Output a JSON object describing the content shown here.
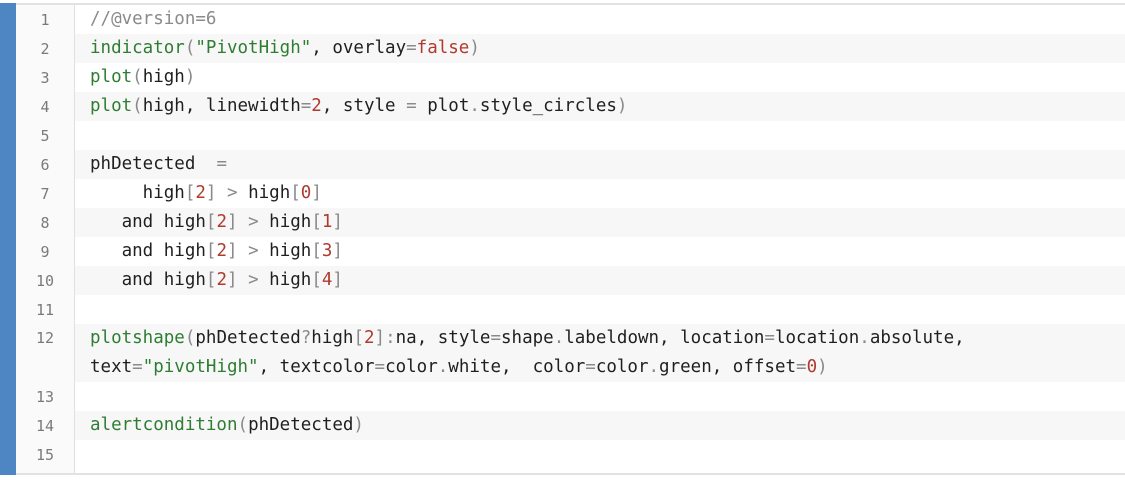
{
  "editor": {
    "accent_color": "#4e86c4",
    "lines": [
      {
        "n": "1",
        "t": "//@version=6"
      },
      {
        "n": "2",
        "t": "indicator(\"PivotHigh\", overlay=false)"
      },
      {
        "n": "3",
        "t": "plot(high)"
      },
      {
        "n": "4",
        "t": "plot(high, linewidth=2, style = plot.style_circles)"
      },
      {
        "n": "5",
        "t": ""
      },
      {
        "n": "6",
        "t": "phDetected  ="
      },
      {
        "n": "7",
        "t": "     high[2] > high[0]"
      },
      {
        "n": "8",
        "t": "   and high[2] > high[1]"
      },
      {
        "n": "9",
        "t": "   and high[2] > high[3]"
      },
      {
        "n": "10",
        "t": "   and high[2] > high[4]"
      },
      {
        "n": "11",
        "t": ""
      },
      {
        "n": "12",
        "t": "plotshape(phDetected?high[2]:na, style=shape.labeldown, location=location.absolute,",
        "t2": "text=\"pivotHigh\", textcolor=color.white,  color=color.green, offset=0)"
      },
      {
        "n": "13",
        "t": ""
      },
      {
        "n": "14",
        "t": "alertcondition(phDetected)"
      },
      {
        "n": "15",
        "t": ""
      }
    ]
  }
}
